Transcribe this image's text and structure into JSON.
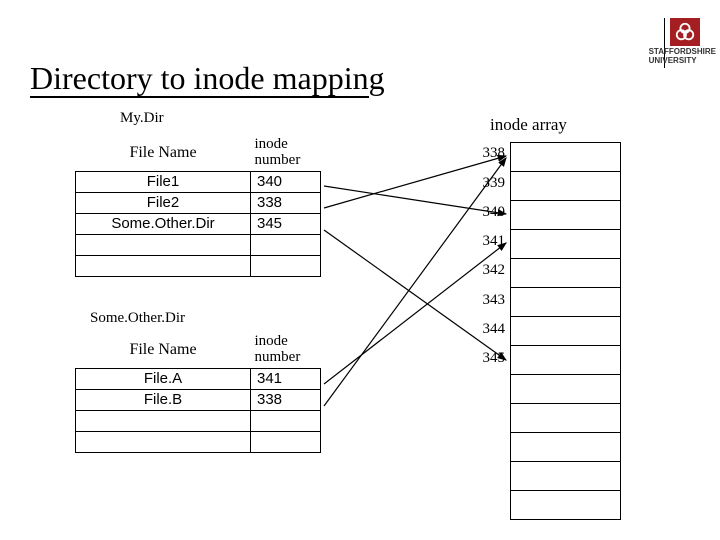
{
  "logo": {
    "line1": "STAFFORDSHIRE",
    "line2": "UNIVERSITY"
  },
  "title_part1": "Directory to inode mappin",
  "title_part2": "g",
  "mydir_label": "My.Dir",
  "sod_label": "Some.Other.Dir",
  "inode_array_label": "inode array",
  "headers": {
    "filename": "File Name",
    "inode_number_l1": "inode",
    "inode_number_l2": "number"
  },
  "table1": [
    {
      "name": "File1",
      "inum": "340"
    },
    {
      "name": "File2",
      "inum": "338"
    },
    {
      "name": "Some.Other.Dir",
      "inum": "345"
    },
    {
      "name": "",
      "inum": ""
    },
    {
      "name": "",
      "inum": ""
    }
  ],
  "table2": [
    {
      "name": "File.A",
      "inum": "341"
    },
    {
      "name": "File.B",
      "inum": "338"
    },
    {
      "name": "",
      "inum": ""
    },
    {
      "name": "",
      "inum": ""
    }
  ],
  "inode_numbers": [
    "338",
    "339",
    "340",
    "341",
    "342",
    "343",
    "344",
    "345"
  ],
  "inode_rows": 13,
  "chart_data": {
    "type": "table",
    "title": "Directory to inode mapping",
    "directories": [
      {
        "name": "My.Dir",
        "entries": [
          {
            "file": "File1",
            "inode": 340
          },
          {
            "file": "File2",
            "inode": 338
          },
          {
            "file": "Some.Other.Dir",
            "inode": 345
          }
        ]
      },
      {
        "name": "Some.Other.Dir",
        "entries": [
          {
            "file": "File.A",
            "inode": 341
          },
          {
            "file": "File.B",
            "inode": 338
          }
        ]
      }
    ],
    "inode_array_visible_indices": [
      338,
      339,
      340,
      341,
      342,
      343,
      344,
      345
    ],
    "arrows": [
      {
        "from": "My.Dir/File1",
        "to_inode": 340
      },
      {
        "from": "My.Dir/File2",
        "to_inode": 338
      },
      {
        "from": "My.Dir/Some.Other.Dir",
        "to_inode": 345
      },
      {
        "from": "Some.Other.Dir/File.A",
        "to_inode": 341
      },
      {
        "from": "Some.Other.Dir/File.B",
        "to_inode": 338
      }
    ]
  }
}
